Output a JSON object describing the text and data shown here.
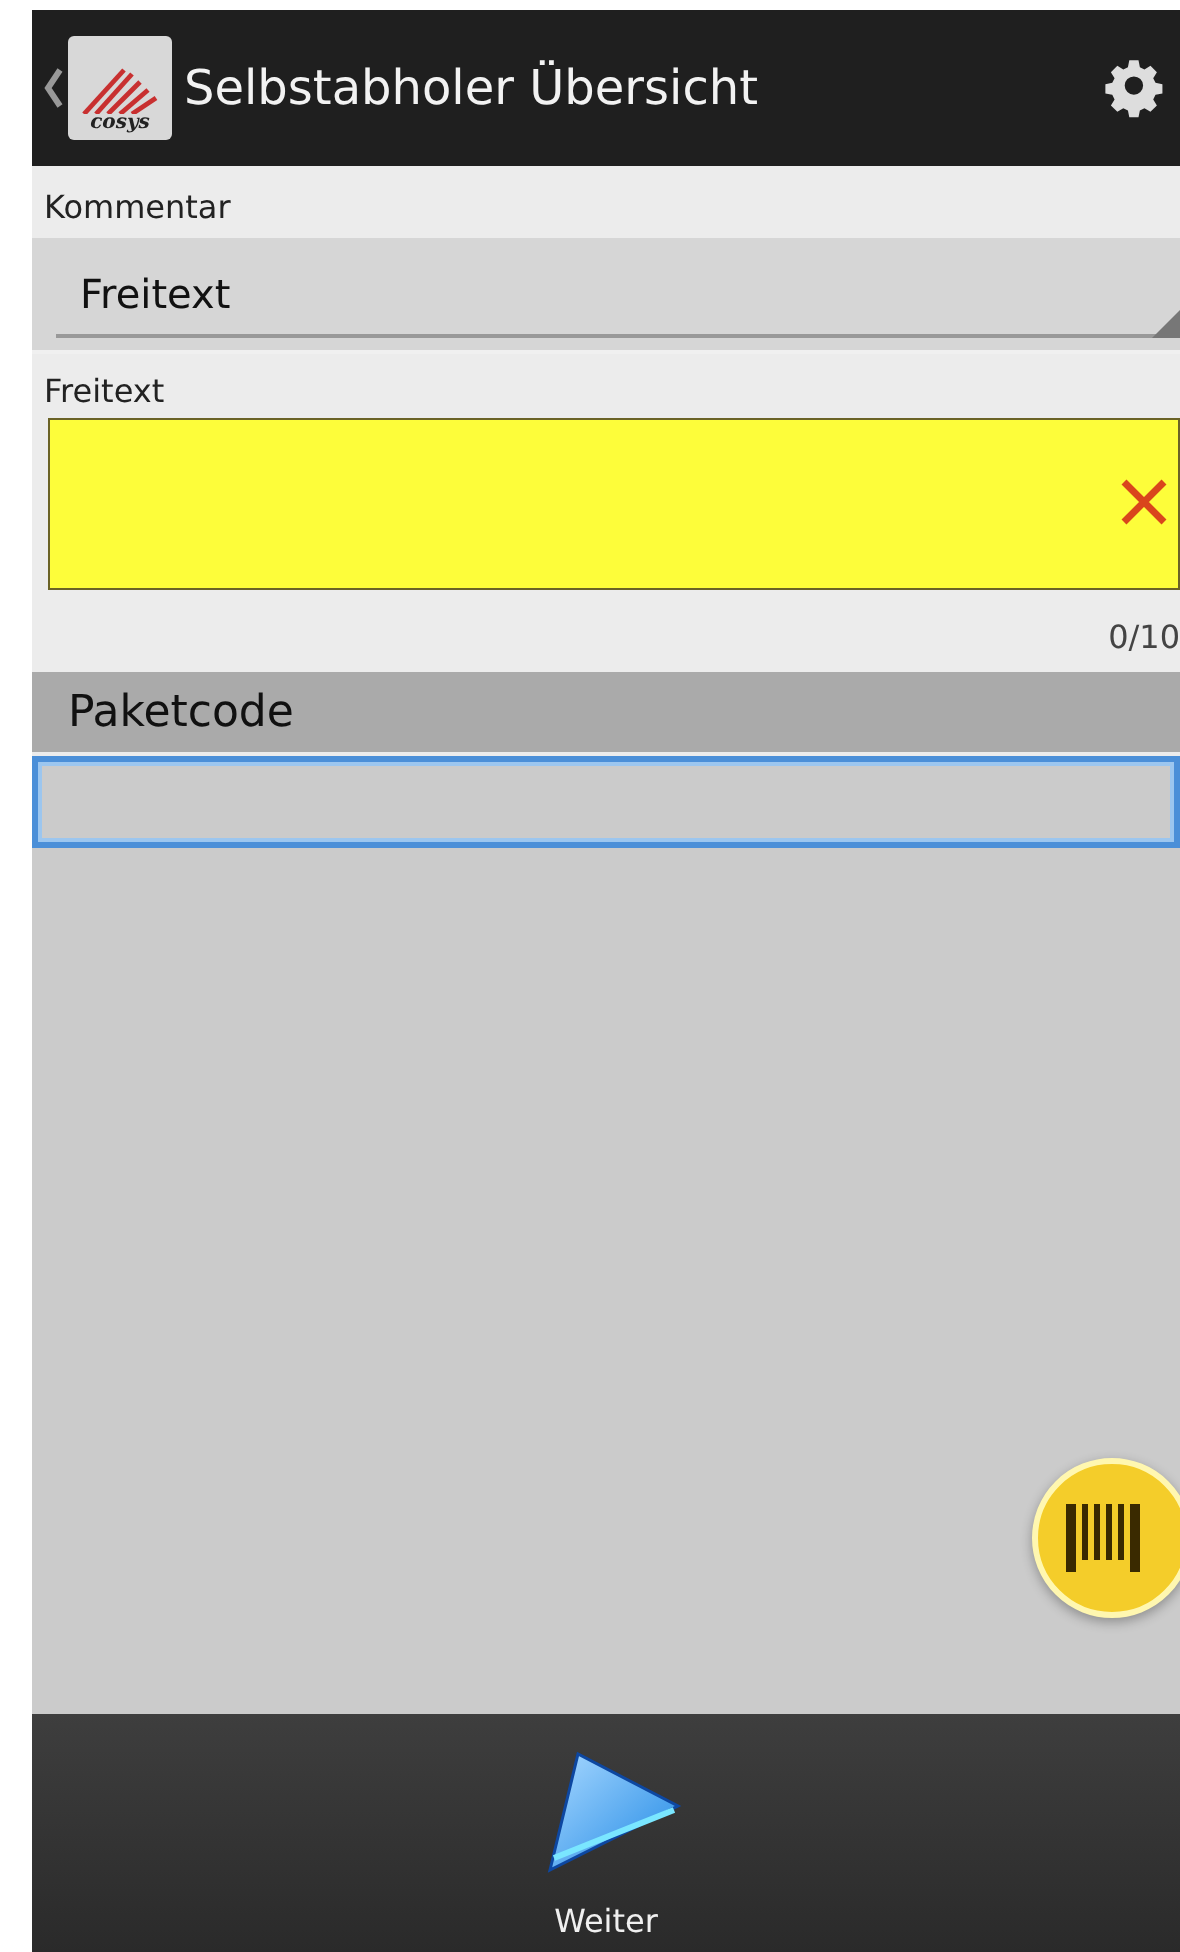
{
  "app_bar": {
    "title": "Selbstabholer Übersicht",
    "logo_text": "cosys"
  },
  "comment": {
    "label": "Kommentar",
    "value": "Freitext"
  },
  "freetext": {
    "label": "Freitext",
    "counter": "0/10"
  },
  "package_code": {
    "label": "Paketcode"
  },
  "bottom_bar": {
    "button": "Weiter"
  }
}
